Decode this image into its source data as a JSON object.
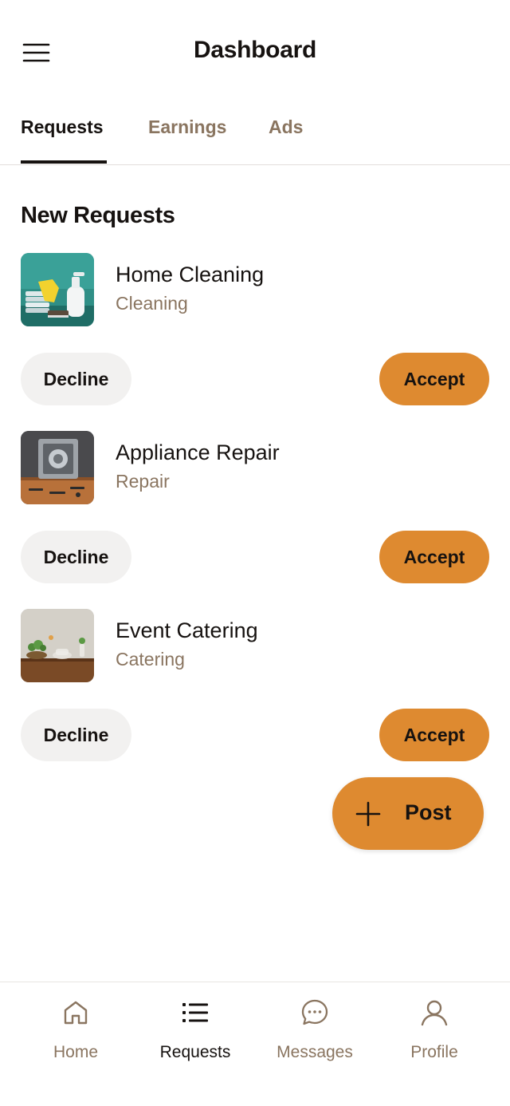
{
  "header": {
    "title": "Dashboard",
    "menu_icon": "hamburger-menu-icon"
  },
  "tabs": [
    {
      "label": "Requests",
      "active": true
    },
    {
      "label": "Earnings",
      "active": false
    },
    {
      "label": "Ads",
      "active": false
    }
  ],
  "section": {
    "title": "New Requests"
  },
  "requests": [
    {
      "title": "Home Cleaning",
      "category": "Cleaning",
      "decline_label": "Decline",
      "accept_label": "Accept",
      "image": "cleaning-supplies-photo"
    },
    {
      "title": "Appliance Repair",
      "category": "Repair",
      "decline_label": "Decline",
      "accept_label": "Accept",
      "image": "appliance-repair-photo"
    },
    {
      "title": "Event Catering",
      "category": "Catering",
      "decline_label": "Decline",
      "accept_label": "Accept",
      "image": "catering-table-photo"
    }
  ],
  "fab": {
    "label": "Post",
    "icon": "plus-icon"
  },
  "bottom_nav": [
    {
      "label": "Home",
      "icon": "home-icon",
      "active": false
    },
    {
      "label": "Requests",
      "icon": "list-icon",
      "active": true
    },
    {
      "label": "Messages",
      "icon": "chat-bubble-icon",
      "active": false
    },
    {
      "label": "Profile",
      "icon": "user-icon",
      "active": false
    }
  ],
  "colors": {
    "accent": "#de8a30",
    "muted_text": "#8a7560",
    "text": "#161210",
    "decline_bg": "#f2f1f0"
  }
}
